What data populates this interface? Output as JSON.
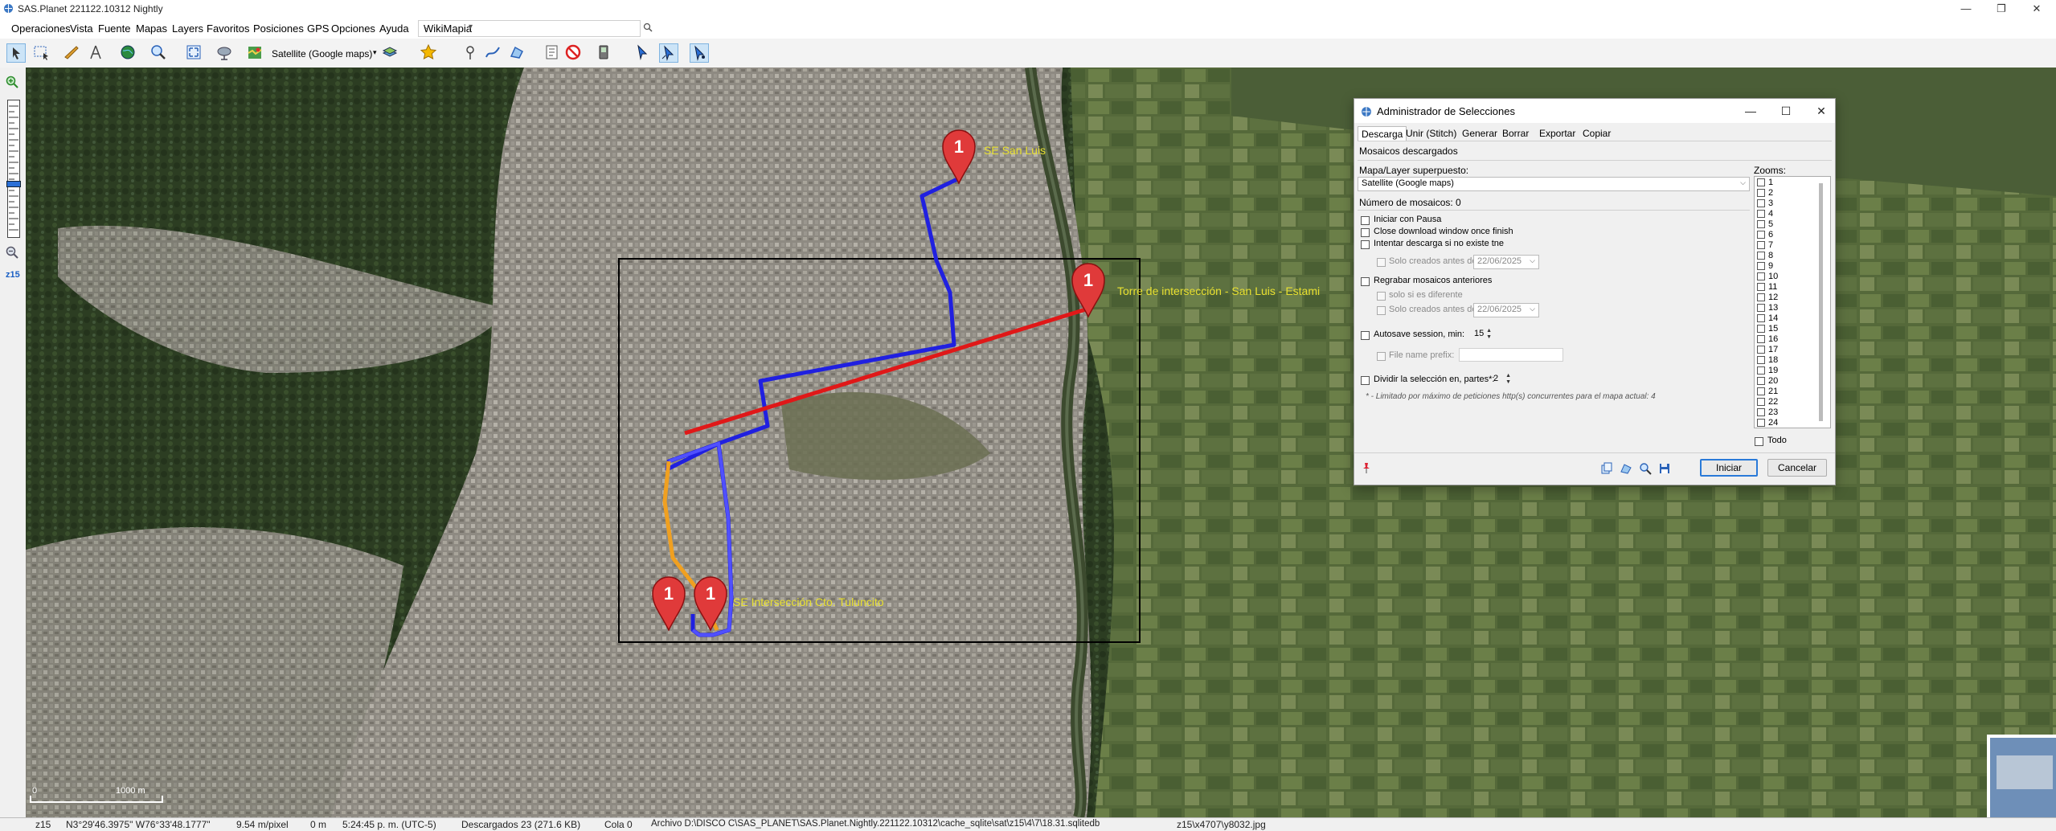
{
  "window": {
    "title": "SAS.Planet 221122.10312 Nightly"
  },
  "menu": {
    "items": [
      "Operaciones",
      "Vista",
      "Fuente",
      "Mapas",
      "Layers",
      "Favoritos",
      "Posiciones",
      "GPS",
      "Opciones",
      "Ayuda"
    ],
    "wiki_combo": "WikiMapia"
  },
  "toolbar": {
    "map_source": "Satellite (Google maps)"
  },
  "left_panel": {
    "zoom_label": "z15"
  },
  "map": {
    "placemarks": [
      {
        "badge": "1",
        "label": "SE San Luis"
      },
      {
        "badge": "1",
        "label": "Torre de intersección - San Luis - Estami"
      },
      {
        "badge": "1",
        "label": ""
      },
      {
        "badge": "1",
        "label": "SE Intersección Cto. Tuluncito"
      }
    ],
    "scale": {
      "zero": "0",
      "km": "1000 m"
    }
  },
  "status": {
    "zoom": "z15",
    "coords": "N3°29'46.3975\" W76°33'48.1777\"",
    "res": "9.54 m/pixel",
    "alt": "0 m",
    "time": "5:24:45 p. m. (UTC-5)",
    "downloaded": "Descargados 23 (271.6 KB)",
    "queue": "Cola 0",
    "file": "Archivo D:\\DISCO C\\SAS_PLANET\\SAS.Planet.Nightly.221122.10312\\cache_sqlite\\sat\\z15\\4\\7\\18.31.sqlitedb",
    "tile": "z15\\x4707\\y8032.jpg"
  },
  "dialog": {
    "title": "Administrador de Selecciones",
    "tabs": [
      "Descarga",
      "Unir (Stitch)",
      "Generar",
      "Borrar",
      "Exportar",
      "Copiar"
    ],
    "section": "Mosaicos descargados",
    "layer_label": "Mapa/Layer superpuesto:",
    "layer_value": "Satellite (Google maps)",
    "count_label": "Número de mosaicos: 0",
    "opt_pause": "Iniciar con Pausa",
    "opt_close": "Close download window once finish",
    "opt_try": "Intentar descarga si no existe tne",
    "opt_only_before": "Solo creados antes de",
    "date1": "22/06/2025",
    "opt_regrab": "Regrabar mosaicos anteriores",
    "opt_if_diff": "solo si es diferente",
    "opt_only_before2": "Solo creados antes de",
    "date2": "22/06/2025",
    "opt_autosave": "Autosave session, min:",
    "autosave_val": "15",
    "opt_prefix": "File name prefix:",
    "opt_split": "Dividir la selección en, partes*:",
    "split_val": "2",
    "note": "* - Limitado por máximo de peticiones http(s) concurrentes para el mapa actual: 4",
    "zooms_label": "Zooms:",
    "zooms": [
      "1",
      "2",
      "3",
      "4",
      "5",
      "6",
      "7",
      "8",
      "9",
      "10",
      "11",
      "12",
      "13",
      "14",
      "15",
      "16",
      "17",
      "18",
      "19",
      "20",
      "21",
      "22",
      "23",
      "24"
    ],
    "all_label": "Todo",
    "start_btn": "Iniciar",
    "cancel_btn": "Cancelar"
  }
}
